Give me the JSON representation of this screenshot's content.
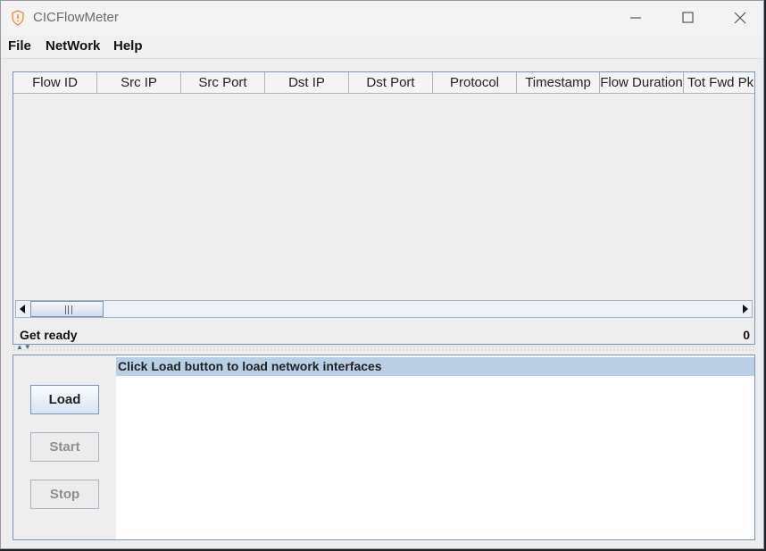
{
  "window": {
    "title": "CICFlowMeter",
    "controls": {
      "minimize": "minimize-icon",
      "maximize": "maximize-icon",
      "close": "close-icon"
    }
  },
  "menubar": {
    "items": [
      "File",
      "NetWork",
      "Help"
    ]
  },
  "flow_table": {
    "columns": [
      "Flow ID",
      "Src IP",
      "Src Port",
      "Dst IP",
      "Dst Port",
      "Protocol",
      "Timestamp",
      "Flow Duration",
      "Tot Fwd Pk"
    ],
    "rows": []
  },
  "status": {
    "message": "Get ready",
    "count": "0"
  },
  "capture_panel": {
    "buttons": [
      {
        "label": "Load",
        "enabled": true
      },
      {
        "label": "Start",
        "enabled": false
      },
      {
        "label": "Stop",
        "enabled": false
      }
    ],
    "interfaces": [
      "Click Load button to load network interfaces"
    ]
  },
  "colors": {
    "accent_border": "#7d94b3",
    "selection": "#b8cfe5",
    "disabled_text": "#8f8f8f",
    "app_icon": "#e8894a"
  }
}
